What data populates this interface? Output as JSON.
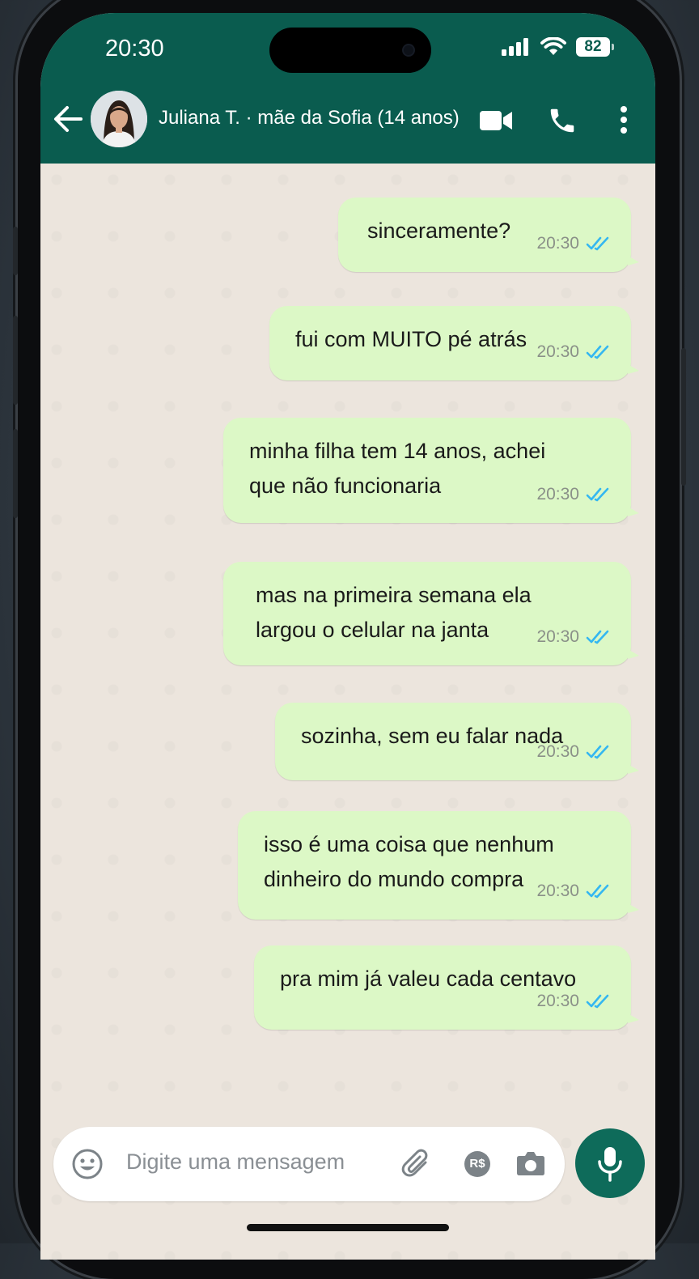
{
  "status_bar": {
    "time": "20:30",
    "battery": "82"
  },
  "header": {
    "contact_name": "Juliana T. · mãe da Sofia (14 anos)",
    "color": "#0a5c4f"
  },
  "messages": [
    {
      "text": "sinceramente?",
      "time": "20:30",
      "status": "read"
    },
    {
      "text": "fui com MUITO pé atrás",
      "time": "20:30",
      "status": "read"
    },
    {
      "lines": [
        "minha filha tem 14 anos, achei",
        "que não funcionaria"
      ],
      "time": "20:30",
      "status": "read"
    },
    {
      "lines": [
        "mas na primeira semana ela",
        "largou o celular na janta"
      ],
      "time": "20:30",
      "status": "read"
    },
    {
      "text": "sozinha, sem eu falar nada",
      "time": "20:30",
      "status": "read"
    },
    {
      "lines": [
        "isso é uma coisa que nenhum",
        "dinheiro do mundo compra"
      ],
      "time": "20:30",
      "status": "read"
    },
    {
      "text": "pra mim já valeu cada centavo",
      "time": "20:30",
      "status": "read"
    }
  ],
  "composer": {
    "placeholder": "Digite uma mensagem",
    "payment_label": "R$"
  },
  "colors": {
    "outgoing_bubble": "#dcf8c6",
    "read_ticks": "#34b7f1",
    "chat_bg": "#ece5dd"
  },
  "icons": [
    "back-arrow-icon",
    "video-call-icon",
    "voice-call-icon",
    "more-options-icon",
    "emoji-icon",
    "attach-icon",
    "payment-icon",
    "camera-icon",
    "mic-icon",
    "read-receipt-icon"
  ]
}
